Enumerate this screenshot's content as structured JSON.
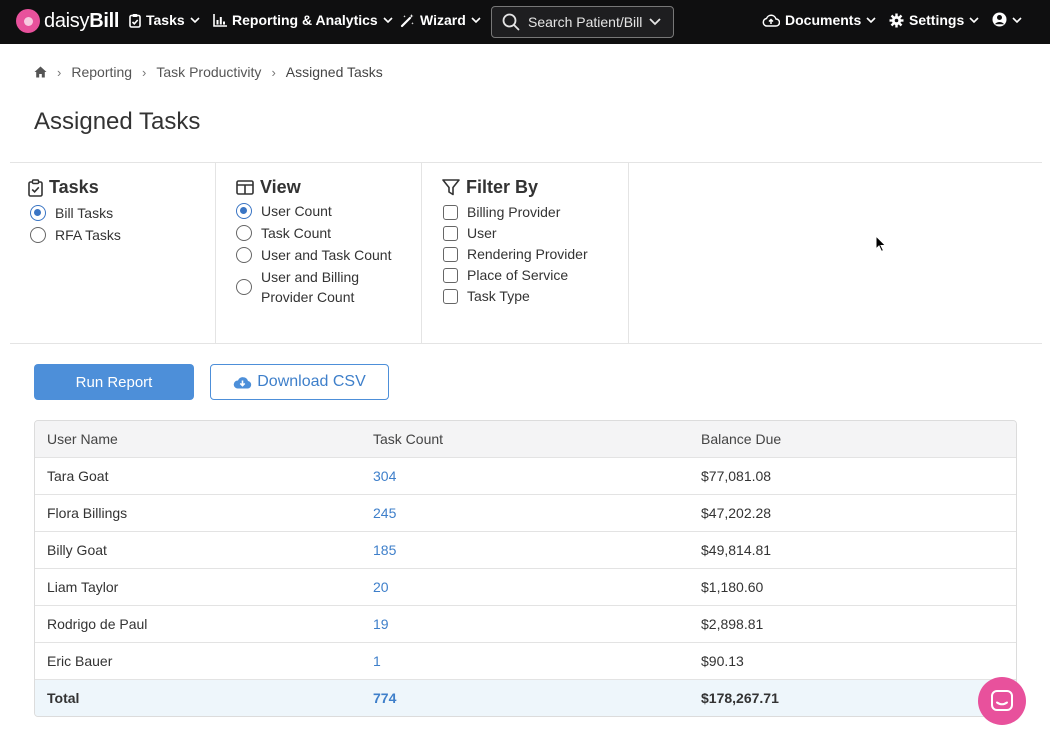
{
  "topnav": {
    "logo_text": "daisyBill",
    "tasks_label": "Tasks",
    "reporting_label": "Reporting & Analytics",
    "wizard_label": "Wizard",
    "search_placeholder": "Search Patient/Bill",
    "documents_label": "Documents",
    "settings_label": "Settings"
  },
  "breadcrumb": {
    "items": [
      "Reporting",
      "Task Productivity",
      "Assigned Tasks"
    ]
  },
  "page_title": "Assigned Tasks",
  "tasks_panel": {
    "heading": "Tasks",
    "options": [
      "Bill Tasks",
      "RFA Tasks"
    ],
    "selected": "Bill Tasks"
  },
  "view_panel": {
    "heading": "View",
    "options": [
      "User Count",
      "Task Count",
      "User and Task Count",
      "User and Billing",
      "Provider Count"
    ],
    "selected": "User Count"
  },
  "filter_panel": {
    "heading": "Filter By",
    "options": [
      "Billing Provider",
      "User",
      "Rendering Provider",
      "Place of Service",
      "Task Type"
    ]
  },
  "buttons": {
    "run_report": "Run Report",
    "download_csv": "Download CSV"
  },
  "table": {
    "headers": [
      "User Name",
      "Task Count",
      "Balance Due"
    ],
    "rows": [
      {
        "user": "Tara Goat",
        "count": "304",
        "balance": "$77,081.08"
      },
      {
        "user": "Flora Billings",
        "count": "245",
        "balance": "$47,202.28"
      },
      {
        "user": "Billy Goat",
        "count": "185",
        "balance": "$49,814.81"
      },
      {
        "user": "Liam Taylor",
        "count": "20",
        "balance": "$1,180.60"
      },
      {
        "user": "Rodrigo de Paul",
        "count": "19",
        "balance": "$2,898.81"
      },
      {
        "user": "Eric Bauer",
        "count": "1",
        "balance": "$90.13"
      }
    ],
    "total": {
      "label": "Total",
      "count": "774",
      "balance": "$178,267.71"
    }
  },
  "colors": {
    "accent": "#4d8fd9",
    "brand": "#e8519c",
    "nav_bg": "#0f0f10"
  }
}
